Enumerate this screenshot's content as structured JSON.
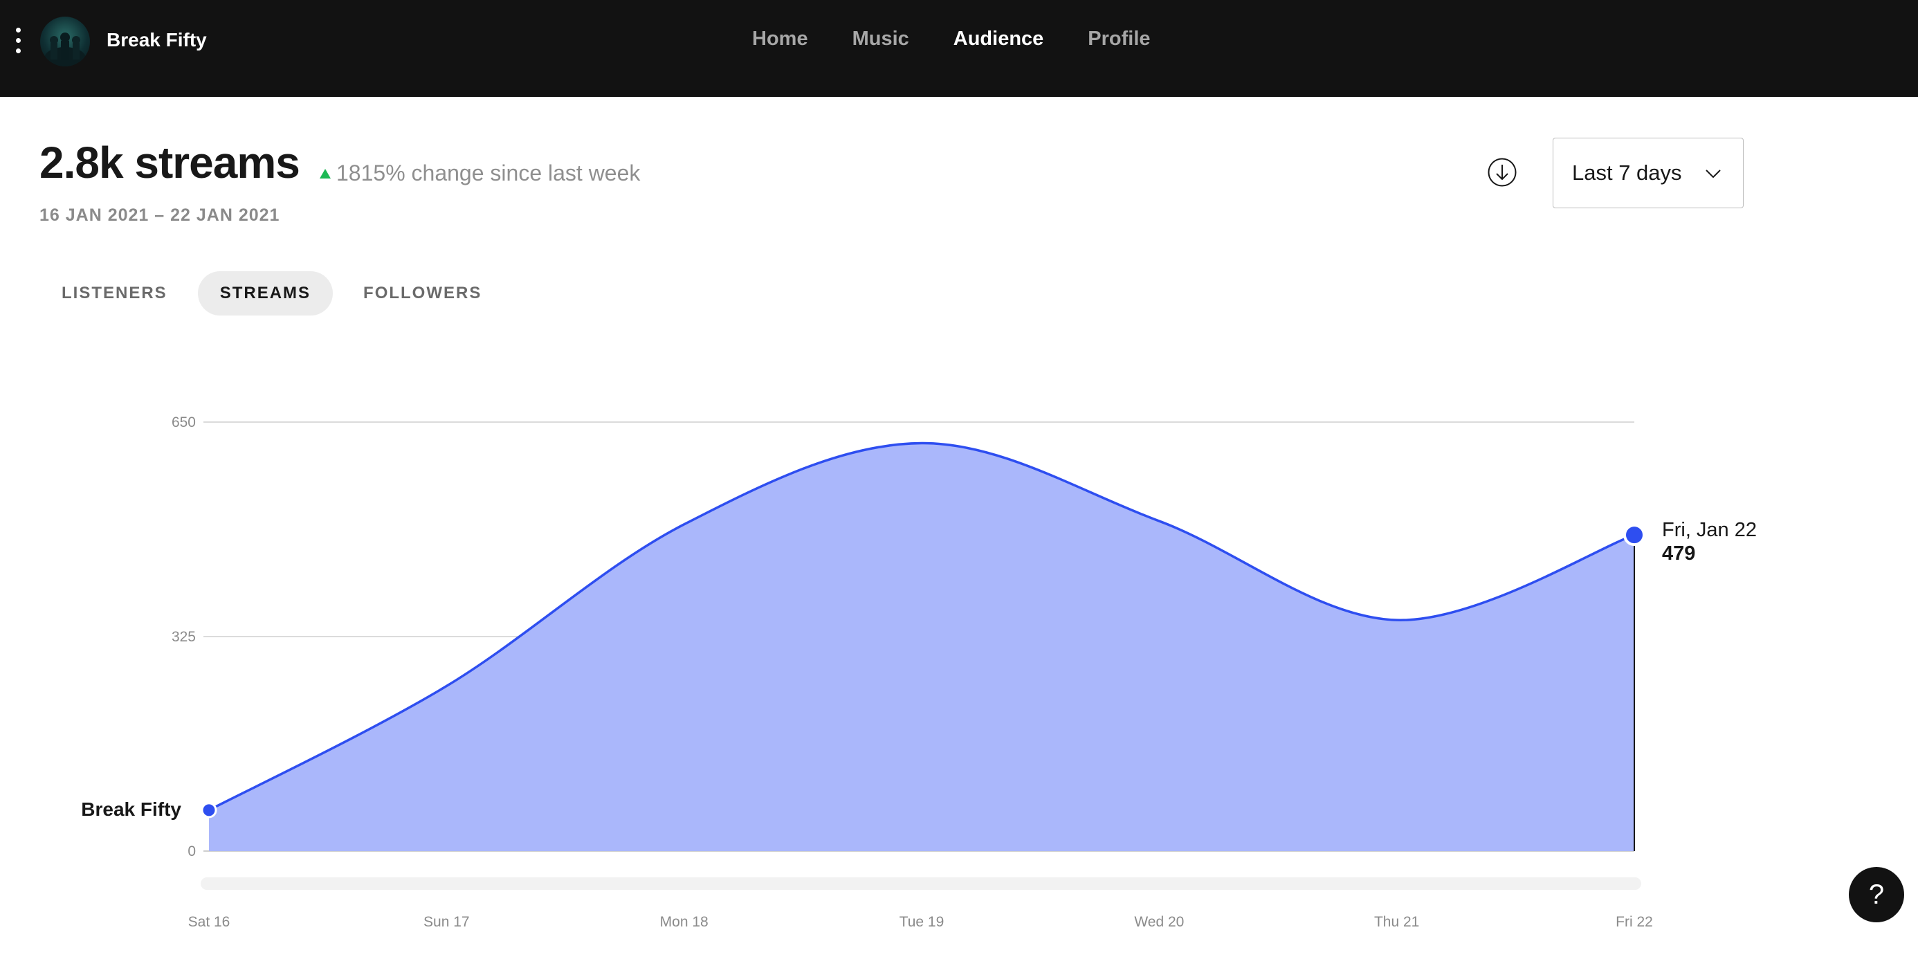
{
  "header": {
    "artist_name": "Break Fifty",
    "nav": [
      {
        "label": "Home",
        "active": false
      },
      {
        "label": "Music",
        "active": false
      },
      {
        "label": "Audience",
        "active": true
      },
      {
        "label": "Profile",
        "active": false
      }
    ]
  },
  "summary": {
    "title": "2.8k streams",
    "change": "1815% change since last week",
    "change_direction": "up",
    "date_range": "16 JAN 2021 – 22 JAN 2021",
    "period_select": "Last 7 days"
  },
  "tabs": [
    {
      "label": "LISTENERS",
      "active": false
    },
    {
      "label": "STREAMS",
      "active": true
    },
    {
      "label": "FOLLOWERS",
      "active": false
    }
  ],
  "colors": {
    "accent": "#2e4ef0",
    "area_fill": "#aab7fb",
    "change_up": "#1db954",
    "topbar": "#121212"
  },
  "chart_data": {
    "type": "area",
    "categories": [
      "Sat 16",
      "Sun 17",
      "Mon 18",
      "Tue 19",
      "Wed 20",
      "Thu 21",
      "Fri 22"
    ],
    "series": [
      {
        "name": "Break Fifty",
        "values": [
          62,
          250,
          495,
          618,
          500,
          350,
          479
        ]
      }
    ],
    "y_ticks": [
      "0",
      "325",
      "650"
    ],
    "ylim": [
      0,
      650
    ],
    "grid": true,
    "tooltip": {
      "date": "Fri, Jan 22",
      "value": "479"
    }
  },
  "help": {
    "label": "?"
  }
}
